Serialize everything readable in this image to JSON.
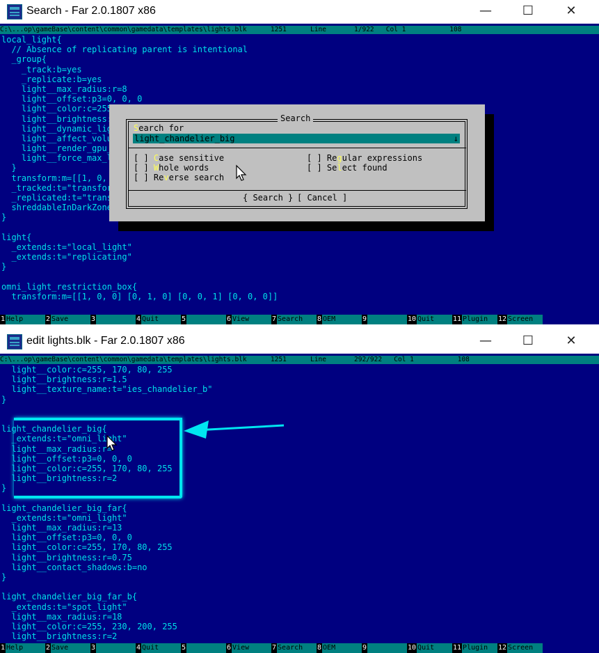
{
  "window1": {
    "title": "Search - Far 2.0.1807 x86",
    "status": "C:\\...op\\gameBase\\content\\common\\gamedata\\templates\\lights.blk      1251      Line       1/922   Col 1           108",
    "code": [
      "local_light{",
      "  // Absence of replicating parent is intentional",
      "  _group{",
      "    _track:b=yes",
      "    _replicate:b=yes",
      "    light__max_radius:r=8",
      "    light__offset:p3=0, 0, 0",
      "    light__color:c=255",
      "    light__brightness:",
      "    light__dynamic_lig",
      "    light__affect_volu",
      "    light__render_gpu_",
      "    light__force_max_l",
      "  }",
      "  transform:m=[[1, 0,",
      "  _tracked:t=\"transfor",
      "  _replicated:t=\"trans",
      "  shreddableInDarkZone",
      "}",
      "",
      "light{",
      "  _extends:t=\"local_light\"",
      "  _extends:t=\"replicating\"",
      "}",
      "",
      "omni_light_restriction_box{",
      "  transform:m=[[1, 0, 0] [0, 1, 0] [0, 0, 1] [0, 0, 0]]"
    ],
    "fkeys": [
      {
        "n": "1",
        "label": "Help"
      },
      {
        "n": "2",
        "label": "Save"
      },
      {
        "n": "3",
        "label": ""
      },
      {
        "n": "4",
        "label": "Quit"
      },
      {
        "n": "5",
        "label": ""
      },
      {
        "n": "6",
        "label": "View"
      },
      {
        "n": "7",
        "label": "Search"
      },
      {
        "n": "8",
        "label": "OEM"
      },
      {
        "n": "9",
        "label": ""
      },
      {
        "n": "10",
        "label": "Quit"
      },
      {
        "n": "11",
        "label": "Plugin"
      },
      {
        "n": "12",
        "label": "Screen"
      }
    ]
  },
  "search_dialog": {
    "title": "Search",
    "search_for_hot": "S",
    "search_for_rest": "earch for",
    "input_value": "light_chandelier_big",
    "case_box": "[ ] ",
    "case_hot": "C",
    "case_rest": "ase sensitive",
    "whole_box": "[ ] ",
    "whole_hot": "W",
    "whole_rest": "hole words",
    "reverse_pre": "[ ] Re",
    "reverse_hot": "v",
    "reverse_rest": "erse search",
    "regex_pre": "[ ] Re",
    "regex_hot": "g",
    "regex_rest": "ular expressions",
    "select_pre": "[ ] Se",
    "select_hot": "l",
    "select_rest": "ect found",
    "search_button": "{ Search }",
    "cancel_button": "[ Cancel ]"
  },
  "window2": {
    "title": "edit lights.blk - Far 2.0.1807 x86",
    "status": "C:\\...op\\gameBase\\content\\common\\gamedata\\templates\\lights.blk      1251      Line       292/922   Col 1           108",
    "code": [
      "  light__color:c=255, 170, 80, 255",
      "  light__brightness:r=1.5",
      "  light__texture_name:t=\"ies_chandelier_b\"",
      "}",
      "",
      "",
      "light_chandelier_big{",
      "  _extends:t=\"omni_light\"",
      "  light__max_radius:r=",
      "  light__offset:p3=0, 0, 0",
      "  light__color:c=255, 170, 80, 255",
      "  light__brightness:r=2",
      "}",
      "",
      "light_chandelier_big_far{",
      "  _extends:t=\"omni_light\"",
      "  light__max_radius:r=13",
      "  light__offset:p3=0, 0, 0",
      "  light__color:c=255, 170, 80, 255",
      "  light__brightness:r=0.75",
      "  light__contact_shadows:b=no",
      "}",
      "",
      "light_chandelier_big_far_b{",
      "  _extends:t=\"spot_light\"",
      "  light__max_radius:r=18",
      "  light__color:c=255, 230, 200, 255",
      "  light__brightness:r=2"
    ],
    "fkeys": [
      {
        "n": "1",
        "label": "Help"
      },
      {
        "n": "2",
        "label": "Save"
      },
      {
        "n": "3",
        "label": ""
      },
      {
        "n": "4",
        "label": "Quit"
      },
      {
        "n": "5",
        "label": ""
      },
      {
        "n": "6",
        "label": "View"
      },
      {
        "n": "7",
        "label": "Search"
      },
      {
        "n": "8",
        "label": "OEM"
      },
      {
        "n": "9",
        "label": ""
      },
      {
        "n": "10",
        "label": "Quit"
      },
      {
        "n": "11",
        "label": "Plugin"
      },
      {
        "n": "12",
        "label": "Screen"
      }
    ]
  },
  "window_controls": {
    "minimize": "—",
    "maximize": "☐",
    "close": "✕"
  },
  "colors": {
    "background": "#000080",
    "text": "#00e0e8",
    "bar": "#008080",
    "dialog": "#c0c0c0",
    "annotation": "#00e5f0"
  },
  "icons": {
    "app": "far-manager-icon",
    "pointer": "mouse-cursor-icon",
    "annotation": "arrow-icon"
  }
}
